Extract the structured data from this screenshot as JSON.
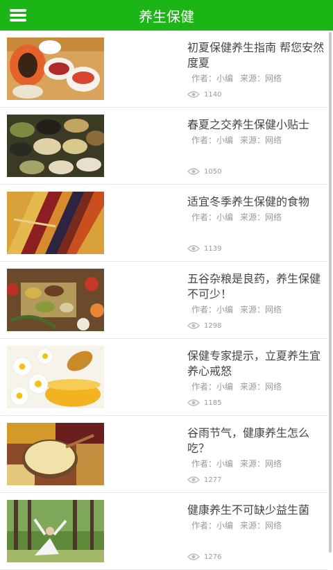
{
  "header": {
    "title": "养生保健",
    "menu_icon": "hamburger-menu-icon"
  },
  "articles": [
    {
      "title": "初夏保健养生指南 帮您安然度夏",
      "author": "作者：小编",
      "source": "来源：网络",
      "views": "1140"
    },
    {
      "title": "春夏之交养生保健小贴士",
      "author": "作者：小编",
      "source": "来源：网络",
      "views": "1050"
    },
    {
      "title": "适宜冬季养生保健的食物",
      "author": "作者：小编",
      "source": "来源：网络",
      "views": "1139"
    },
    {
      "title": "五谷杂粮是良药，养生保健不可少！",
      "author": "作者：小编",
      "source": "来源：网络",
      "views": "1298"
    },
    {
      "title": "保健专家提示，立夏养生宜养心戒怒",
      "author": "作者：小编",
      "source": "来源：网络",
      "views": "1185"
    },
    {
      "title": "谷雨节气，健康养生怎么吃？",
      "author": "作者：小编",
      "source": "来源：网络",
      "views": "1277"
    },
    {
      "title": "健康养生不可缺少益生菌",
      "author": "作者：小编",
      "source": "来源：网络",
      "views": "1276"
    }
  ],
  "colors": {
    "header": "#1bb616"
  }
}
